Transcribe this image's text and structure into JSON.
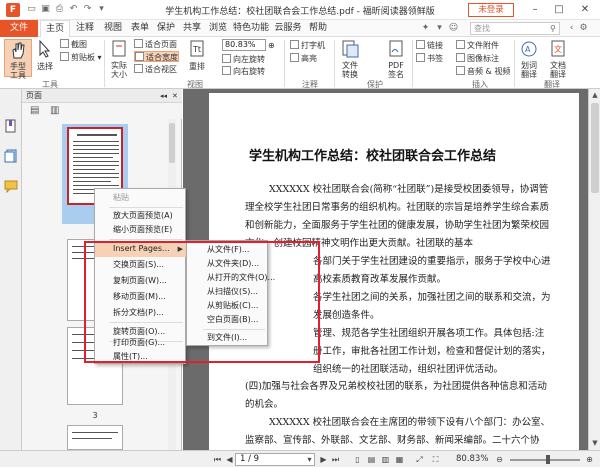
{
  "app": {
    "logo_glyph": "F",
    "title": "学生机构工作总结：校社团联合会工作总结.pdf - 福昕阅读器领鲜版",
    "login": "未登录"
  },
  "tabs": {
    "file": "文件",
    "items": [
      "主页",
      "注释",
      "视图",
      "表单",
      "保护",
      "共享",
      "浏览",
      "特色功能",
      "云服务",
      "帮助"
    ],
    "search_placeholder": "查找"
  },
  "ribbon": {
    "hand": "手型\n工具",
    "select": "选择",
    "screenshot": "截图",
    "clipboard": "剪贴板",
    "tools_group": "工具",
    "actual_size": "实际\n大小",
    "fit_page": "适合页面",
    "fit_width": "适合宽度",
    "fit_area": "适合视区",
    "reflow": "重排",
    "zoom_value": "80.83%",
    "rotate_left": "向左旋转",
    "rotate_right": "向右旋转",
    "view_group": "视图",
    "typewriter": "打字机",
    "highlight": "高亮",
    "comment_group": "注释",
    "file_convert": "文件\n转换",
    "pdf_sign": "PDF\n签名",
    "protect_group": "保护",
    "link": "链接",
    "bookmark": "书签",
    "file_attach": "文件附件",
    "image_note": "图像标注",
    "audio_video": "音频 & 视频",
    "insert_group": "插入",
    "word_translate": "划词\n翻译",
    "doc_translate": "文档\n翻译",
    "translate_group": "翻译"
  },
  "panel": {
    "title": "页面",
    "page3": "3"
  },
  "context_menu": {
    "items": [
      {
        "label": "粘贴",
        "disabled": true
      },
      {
        "label": "放大页面预览(A)",
        "disabled": false
      },
      {
        "label": "缩小页面预览(E)",
        "disabled": false
      },
      {
        "label": "Insert Pages...",
        "disabled": false,
        "submenu": true
      },
      {
        "label": "交换页面(S)...",
        "disabled": false
      },
      {
        "label": "复制页面(W)...",
        "disabled": false
      },
      {
        "label": "移动页面(M)...",
        "disabled": false
      },
      {
        "label": "拆分文档(P)...",
        "disabled": false
      },
      {
        "label": "旋转页面(O)...",
        "disabled": false
      },
      {
        "label": "打印页面(G)...",
        "disabled": false
      },
      {
        "label": "属性(T)...",
        "disabled": false
      }
    ]
  },
  "submenu": {
    "items": [
      "从文件(F)...",
      "从文件夹(D)...",
      "从打开的文件(O)...",
      "从扫描仪(S)...",
      "从剪贴板(C)...",
      "空白页面(B)...",
      "到文件(I)..."
    ]
  },
  "document": {
    "title": "学生机构工作总结：校社团联合会工作总结",
    "paragraphs": [
      "XXXXXX 校社团联合会(简称“社团联”)是接受校团委领导，协调管理全校学生社团日常事务的组织机构。社团联的宗旨是培养学生综合素质和创新能力，全面服务于学生社团的健康发展，协助学生社团为繁荣校园文化、创建校园精神文明作出更大贡献。社团联的基本",
      "各部门关于学生社团建设的重要指示，服务于学校中心进高校素质教育改革发展作贡献。",
      "各学生社团之间的关系，加强社团之间的联系和交流，为发展创造条件。",
      "管理、规范各学生社团组织开展各项工作。具体包括:注册工作，审批各社团工作计划，检查和督促计划的落实，组织统一的社团联活动，组织社团评优活动。",
      "(四)加强与社会各界及兄弟校校社团的联系，为社团提供各种信息和活动的机会。",
      "XXXXXX 校社团联合会在主席团的带领下设有八个部门：办公室、监察部、宣传部、外联部、文艺部、财务部、新闻采编部。二十六个协会：XX"
    ]
  },
  "status": {
    "page_display": "1 / 9",
    "zoom": "80.83%"
  }
}
